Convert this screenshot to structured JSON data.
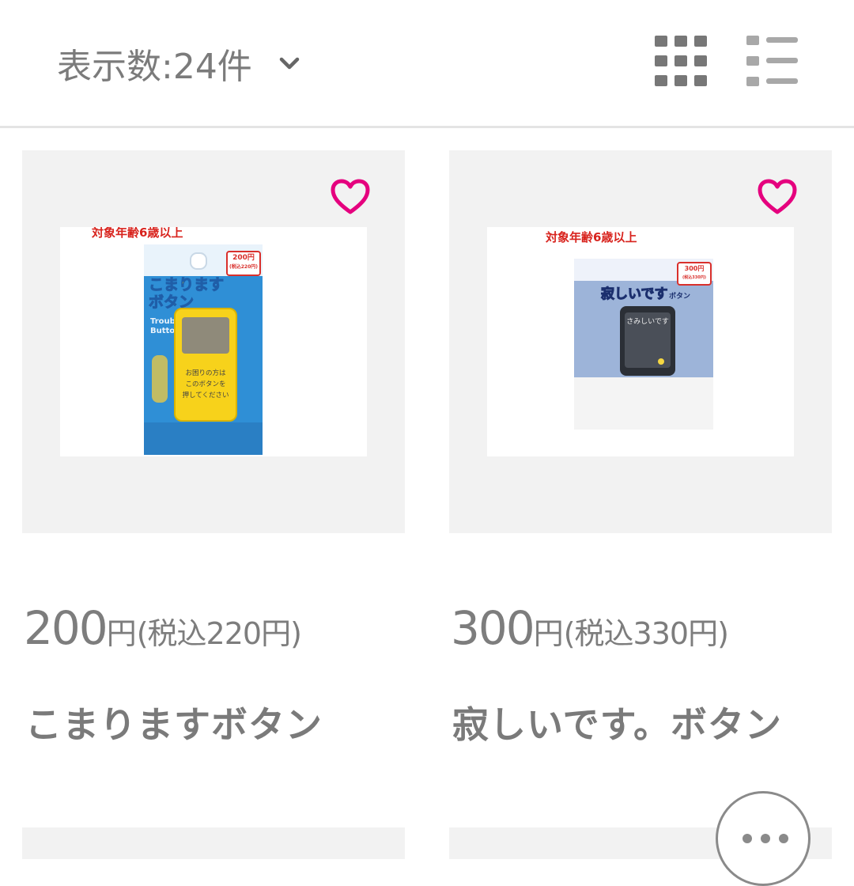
{
  "toolbar": {
    "display_count_label": "表示数:24件",
    "dropdown_icon": "chevron-down-icon",
    "grid_view_icon": "grid-view-icon",
    "list_view_icon": "list-view-icon"
  },
  "products": [
    {
      "price_main": "200",
      "price_yen": "円",
      "price_tax": "(税込220円)",
      "name": "こまりますボタン",
      "favorite_icon": "heart-icon",
      "favorite_color": "#e5007e",
      "photo": {
        "age_text": "対象年齢6歳以上",
        "title_line1": "こまります",
        "title_line2": "ボタン",
        "price_tag": "200円",
        "price_tag_sub": "(税込220円)",
        "button_text_1": "お困りの方は",
        "button_text_2": "このボタンを",
        "button_text_3": "押してください",
        "english": "Trouble Button"
      }
    },
    {
      "price_main": "300",
      "price_yen": "円",
      "price_tax": "(税込330円)",
      "name": "寂しいです。ボタン",
      "favorite_icon": "heart-icon",
      "favorite_color": "#e5007e",
      "photo": {
        "age_text": "対象年齢6歳以上",
        "title": "寂しいです",
        "subtitle": "ボタン",
        "price_tag": "300円",
        "price_tag_sub": "(税込330円)",
        "button_text": "さみしいです"
      }
    }
  ],
  "chat_button": {
    "icon": "more-dots-icon"
  }
}
